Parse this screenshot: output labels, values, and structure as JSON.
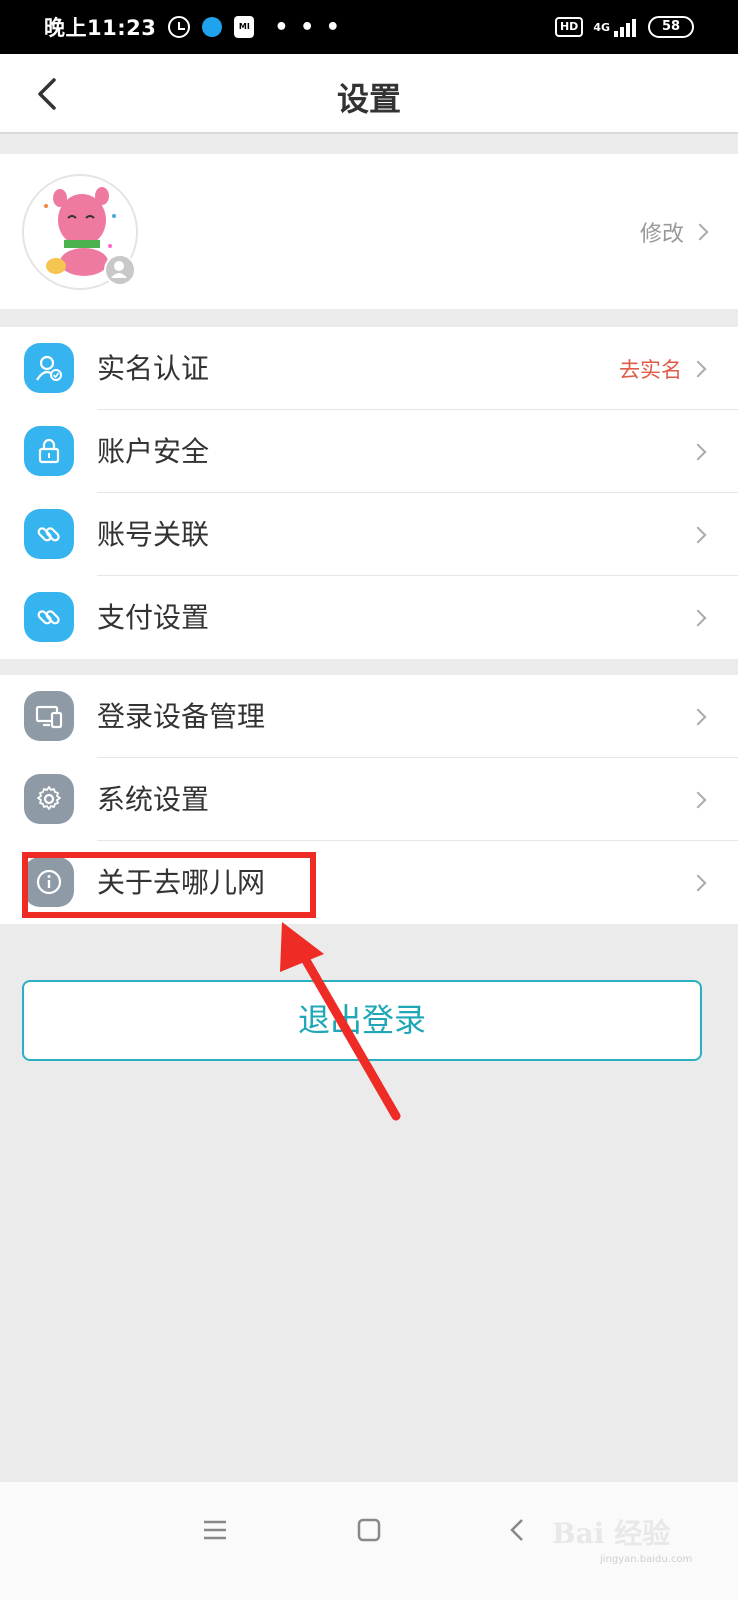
{
  "status_bar": {
    "time": "晚上11:23",
    "dots": "• • •",
    "hd": "HD",
    "network": "4G",
    "battery": "58"
  },
  "header": {
    "title": "设置",
    "back_icon": "chevron-left-icon"
  },
  "profile": {
    "edit_label": "修改"
  },
  "section_one": {
    "items": [
      {
        "label": "实名认证",
        "hint": "去实名",
        "icon": "user-verify-icon"
      },
      {
        "label": "账户安全",
        "hint": "",
        "icon": "lock-icon"
      },
      {
        "label": "账号关联",
        "hint": "",
        "icon": "link-icon"
      },
      {
        "label": "支付设置",
        "hint": "",
        "icon": "link-icon"
      }
    ]
  },
  "section_two": {
    "items": [
      {
        "label": "登录设备管理",
        "icon": "devices-icon"
      },
      {
        "label": "系统设置",
        "icon": "gear-icon"
      },
      {
        "label": "关于去哪儿网",
        "icon": "info-icon"
      }
    ]
  },
  "logout": {
    "label": "退出登录"
  },
  "watermark": {
    "brand": "Bai 经验",
    "url": "jingyan.baidu.com"
  },
  "colors": {
    "accent_blue": "#36b4f0",
    "teal": "#1fa7b8",
    "highlight_red": "#ee2b24",
    "hint_red": "#e05b49"
  }
}
